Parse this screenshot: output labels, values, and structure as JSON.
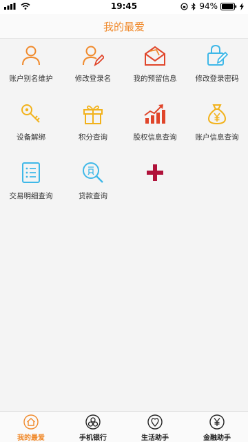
{
  "status_bar": {
    "time": "19:45",
    "battery": "94%"
  },
  "header": {
    "title": "我的最爱"
  },
  "favorites": [
    {
      "label": "账户别名维护",
      "icon": "user-icon"
    },
    {
      "label": "修改登录名",
      "icon": "user-edit-icon"
    },
    {
      "label": "我的预留信息",
      "icon": "envelope-icon"
    },
    {
      "label": "修改登录密码",
      "icon": "password-edit-icon"
    },
    {
      "label": "设备解绑",
      "icon": "key-icon"
    },
    {
      "label": "积分查询",
      "icon": "gift-icon"
    },
    {
      "label": "股权信息查询",
      "icon": "stock-chart-icon"
    },
    {
      "label": "账户信息查询",
      "icon": "money-bag-icon"
    },
    {
      "label": "交易明细查询",
      "icon": "list-icon"
    },
    {
      "label": "贷款查询",
      "icon": "loan-search-icon"
    }
  ],
  "add_button": {
    "icon": "plus-icon"
  },
  "tabs": [
    {
      "label": "我的最爱",
      "icon": "home-icon",
      "active": true
    },
    {
      "label": "手机银行",
      "icon": "mobile-bank-icon",
      "active": false
    },
    {
      "label": "生活助手",
      "icon": "life-icon",
      "active": false
    },
    {
      "label": "金融助手",
      "icon": "finance-icon",
      "active": false
    }
  ],
  "colors": {
    "accent": "#f08a2c",
    "red": "#e0452a",
    "blue": "#3fb8e8",
    "yellow": "#f2b21b",
    "plus": "#b0123a"
  }
}
